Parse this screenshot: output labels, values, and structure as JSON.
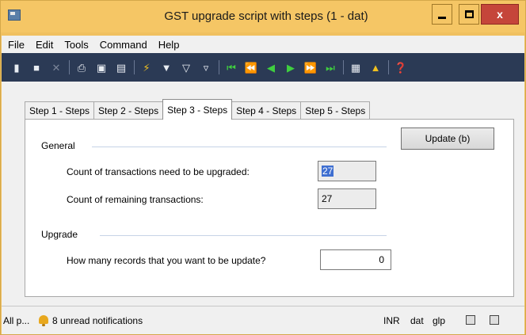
{
  "window": {
    "title": "GST upgrade script with steps (1 - dat)",
    "close_glyph": "x",
    "accent_color": "#f5c665"
  },
  "menu": {
    "items": [
      {
        "label": "File"
      },
      {
        "label": "Edit"
      },
      {
        "label": "Tools"
      },
      {
        "label": "Command"
      },
      {
        "label": "Help"
      }
    ]
  },
  "toolbar": {
    "icons": [
      "new-icon",
      "save-icon",
      "delete-icon",
      "print-icon",
      "print-preview-icon",
      "export-icon",
      "filter-selection-icon",
      "filter-by-form-icon",
      "advanced-filter-icon",
      "remove-filter-icon",
      "first-record-icon",
      "previous-page-icon",
      "previous-record-icon",
      "next-record-icon",
      "next-page-icon",
      "last-record-icon",
      "attachments-icon",
      "alert-icon",
      "help-icon"
    ]
  },
  "tabs": [
    {
      "label": "Step 1 - Steps"
    },
    {
      "label": "Step 2 - Steps"
    },
    {
      "label": "Step 3 - Steps",
      "active": true
    },
    {
      "label": "Step 4 - Steps"
    },
    {
      "label": "Step 5 - Steps"
    }
  ],
  "form": {
    "update_button": "Update (b)",
    "general": {
      "label": "General",
      "count_to_upgrade_label": "Count of transactions need to be upgraded:",
      "count_to_upgrade_value": "27",
      "count_remaining_label": "Count of remaining transactions:",
      "count_remaining_value": "27"
    },
    "upgrade": {
      "label": "Upgrade",
      "records_label": "How many records that you want to be update?",
      "records_value": "0"
    }
  },
  "statusbar": {
    "all_label": "All p...",
    "notifications": "8 unread notifications",
    "currency": "INR",
    "company": "dat",
    "partition": "glp"
  }
}
